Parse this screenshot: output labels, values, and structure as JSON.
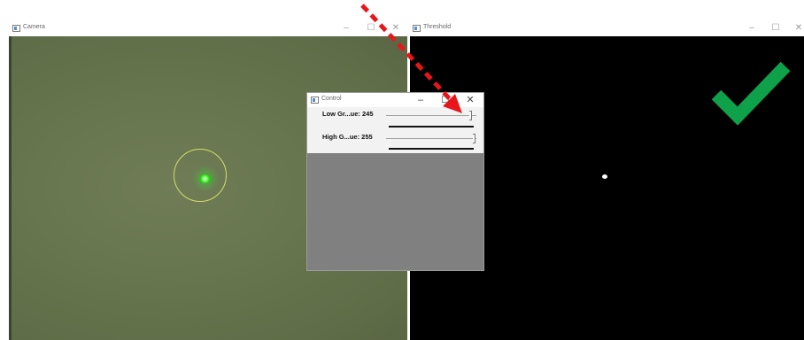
{
  "camera": {
    "title": "Camera",
    "controls": {
      "minimize": "–",
      "maximize": "☐",
      "close": "✕"
    }
  },
  "threshold": {
    "title": "Threshold",
    "controls": {
      "minimize": "–",
      "maximize": "☐",
      "close": "✕"
    }
  },
  "control": {
    "title": "Control",
    "controls": {
      "minimize": "–",
      "maximize": "☐",
      "close": "✕"
    },
    "trackbars": [
      {
        "label": "Low Gr...ue: 245",
        "value": 245,
        "max": 255
      },
      {
        "label": "High G...ue: 255",
        "value": 255,
        "max": 255
      }
    ]
  },
  "colors": {
    "arrow": "#e8161b",
    "checkmark": "#0fa04a",
    "detection_ring": "#d4dd6a",
    "laser": "#3cf030"
  },
  "icons": [
    "window-icon",
    "minimize-icon",
    "maximize-icon",
    "close-icon",
    "checkmark-icon",
    "arrow-icon"
  ]
}
